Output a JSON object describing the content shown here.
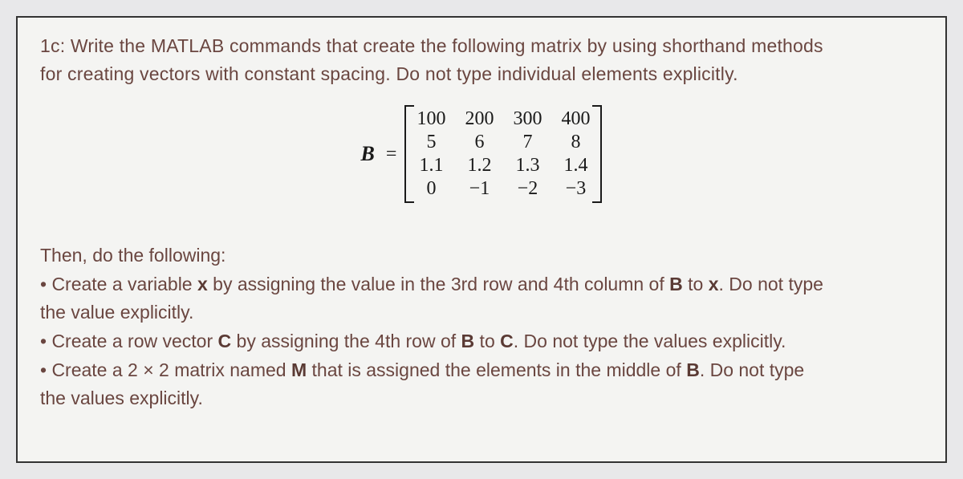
{
  "problem": {
    "id": "1c",
    "intro_line1": "1c: Write the MATLAB commands that create the following matrix by using shorthand methods",
    "intro_line2": "for creating vectors with constant spacing. Do not type individual elements explicitly."
  },
  "matrix": {
    "label": "B",
    "equals": "=",
    "rows": [
      [
        "100",
        "200",
        "300",
        "400"
      ],
      [
        "5",
        "6",
        "7",
        "8"
      ],
      [
        "1.1",
        "1.2",
        "1.3",
        "1.4"
      ],
      [
        "0",
        "−1",
        "−2",
        "−3"
      ]
    ]
  },
  "tasks": {
    "header": "Then, do the following:",
    "b1_pre": "• Create a variable ",
    "b1_x": "x",
    "b1_mid": " by assigning the value in the 3rd row and 4th column of ",
    "b1_B": "B",
    "b1_to": " to ",
    "b1_x2": "x",
    "b1_end": ". Do not type",
    "b1_line2": "the value explicitly.",
    "b2_pre": "• Create a row vector ",
    "b2_C": "C",
    "b2_mid": " by assigning the 4th row of ",
    "b2_B": "B",
    "b2_to": " to ",
    "b2_C2": "C",
    "b2_end": ". Do not type the values explicitly.",
    "b3_pre": "• Create a 2 × 2 matrix named ",
    "b3_M": "M",
    "b3_mid": " that is assigned the elements in the middle of ",
    "b3_B": "B",
    "b3_end": ". Do not type",
    "b3_line2": "the values explicitly."
  }
}
